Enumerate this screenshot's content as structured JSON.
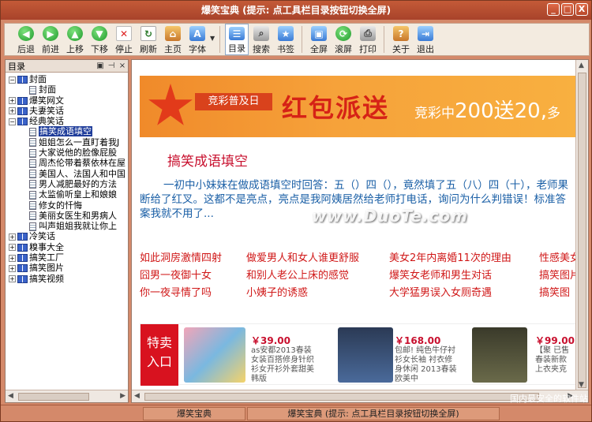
{
  "window": {
    "title": "爆笑宝典 (提示: 点工具栏目录按钮切换全屏)",
    "controls": [
      "_",
      "□",
      "X"
    ]
  },
  "toolbar": {
    "buttons": [
      {
        "label": "后退",
        "icon": "back-arrow-icon"
      },
      {
        "label": "前进",
        "icon": "forward-arrow-icon"
      },
      {
        "label": "上移",
        "icon": "up-arrow-icon"
      },
      {
        "label": "下移",
        "icon": "down-arrow-icon"
      },
      {
        "label": "停止",
        "icon": "stop-icon"
      },
      {
        "label": "刷新",
        "icon": "refresh-icon"
      },
      {
        "label": "主页",
        "icon": "home-icon"
      },
      {
        "label": "字体",
        "icon": "font-icon"
      },
      {
        "label": "目录",
        "icon": "directory-icon"
      },
      {
        "label": "搜索",
        "icon": "search-icon"
      },
      {
        "label": "书签",
        "icon": "bookmark-icon"
      },
      {
        "label": "全屏",
        "icon": "fullscreen-icon"
      },
      {
        "label": "滚屏",
        "icon": "autoscroll-icon"
      },
      {
        "label": "打印",
        "icon": "print-icon"
      },
      {
        "label": "关于",
        "icon": "about-icon"
      },
      {
        "label": "退出",
        "icon": "exit-icon"
      }
    ]
  },
  "directory": {
    "title": "目录",
    "header_buttons": [
      "▣",
      "⊣",
      "×"
    ],
    "nodes": [
      {
        "label": "封面",
        "level": 0,
        "expanded": true
      },
      {
        "label": "封面",
        "level": 1
      },
      {
        "label": "爆笑网文",
        "level": 0,
        "expanded": false
      },
      {
        "label": "夫妻笑话",
        "level": 0,
        "expanded": false
      },
      {
        "label": "经典笑话",
        "level": 0,
        "expanded": true
      },
      {
        "label": "搞笑成语填空",
        "level": 1,
        "selected": true
      },
      {
        "label": "姐姐怎么一直盯着我J",
        "level": 1
      },
      {
        "label": "大家说他的脸像屁股",
        "level": 1
      },
      {
        "label": "周杰伦带着蔡依林在屋",
        "level": 1
      },
      {
        "label": "美国人、法国人和中国",
        "level": 1
      },
      {
        "label": "男人减肥最好的方法",
        "level": 1
      },
      {
        "label": "太监偷听皇上和娘娘",
        "level": 1
      },
      {
        "label": "修女的忏悔",
        "level": 1
      },
      {
        "label": "美丽女医生和男病人",
        "level": 1
      },
      {
        "label": "叫声姐姐我就让你上",
        "level": 1
      },
      {
        "label": "冷笑话",
        "level": 0,
        "expanded": false
      },
      {
        "label": "糗事大全",
        "level": 0,
        "expanded": false
      },
      {
        "label": "搞笑工厂",
        "level": 0,
        "expanded": false
      },
      {
        "label": "搞笑图片",
        "level": 0,
        "expanded": false
      },
      {
        "label": "搞笑视频",
        "level": 0,
        "expanded": false
      }
    ]
  },
  "banner": {
    "chip": "竞彩普及日",
    "headline": "红包派送",
    "promo_prefix": "竞彩中",
    "promo_big": "200送20,",
    "promo_suffix": "多"
  },
  "article": {
    "title": "搞笑成语填空",
    "body": "一初中小妹妹在做成语填空时回答：五（）四（），竟然填了五（八）四（十），老师果断给了红叉。这都不是亮点，亮点是我阿姨居然给老师打电话，询问为什么判错误！标准答案我就不用了..."
  },
  "watermark": "www.DuoTe.com",
  "links": [
    [
      "如此洞房激情四射",
      "做爱男人和女人谁更舒服",
      "美女2年内离婚11次的理由",
      "性感美女"
    ],
    [
      "囧男一夜御十女",
      "和别人老公上床的感觉",
      "爆笑女老师和男生对话",
      "搞笑图片"
    ],
    [
      "你一夜寻情了吗",
      "小姨子的诱惑",
      "大学猛男误入女厕奇遇",
      "搞笑图"
    ]
  ],
  "ad": {
    "label_line1": "特卖",
    "label_line2": "入口",
    "items": [
      {
        "price": "￥39.00",
        "desc": "as安都2013春装女装百搭修身针织衫女开衫外套甜美韩版"
      },
      {
        "price": "￥168.00",
        "desc": "包邮! 纯色牛仔衬衫女长袖 衬衣修身休闲 2013春装欧美中"
      },
      {
        "price": "￥99.00",
        "desc": "【聚 已售春装新款 上衣夹克"
      }
    ]
  },
  "statusbar": {
    "left": "爆笑宝典",
    "right": "爆笑宝典 (提示: 点工具栏目录按钮切换全屏)"
  },
  "corner_watermark": "国内最安全的软件站"
}
